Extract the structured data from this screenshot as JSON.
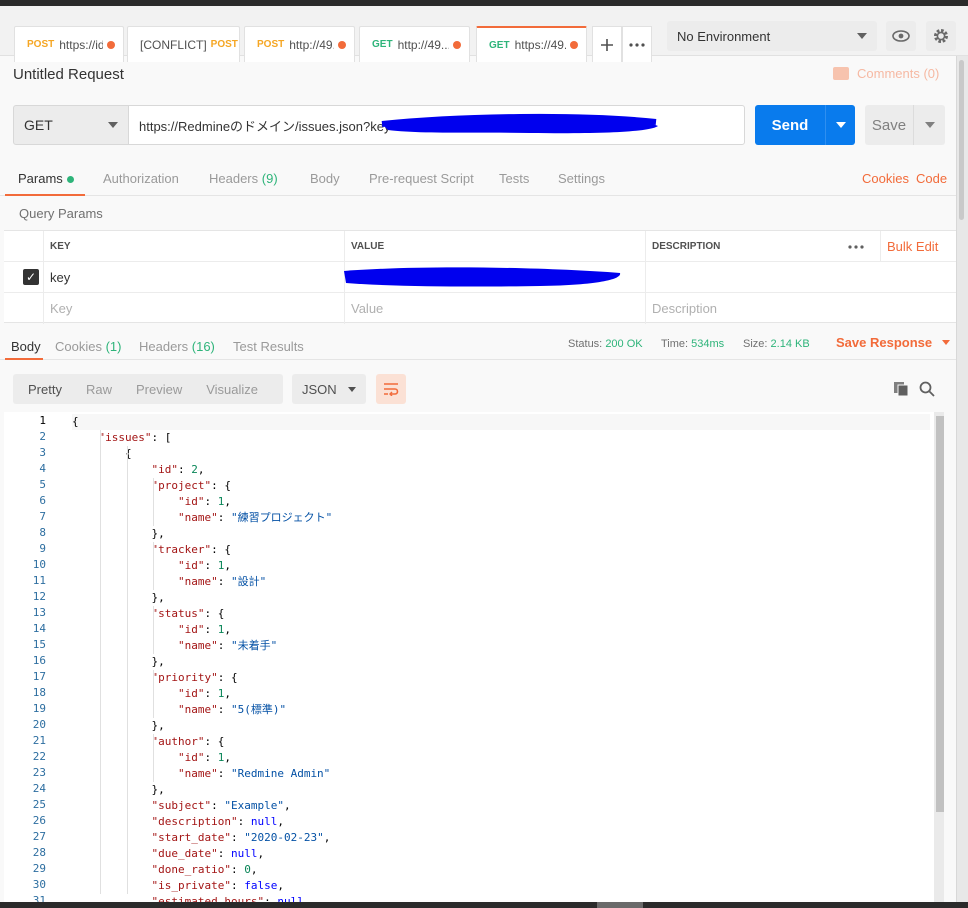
{
  "tabs": [
    {
      "method": "POST",
      "url": "https://id..."
    },
    {
      "method": "POST",
      "url": "",
      "prefix": "[CONFLICT]"
    },
    {
      "method": "POST",
      "url": "http://49...."
    },
    {
      "method": "GET",
      "url": "http://49...."
    },
    {
      "method": "GET",
      "url": "https://49...."
    }
  ],
  "environment": {
    "selected": "No Environment"
  },
  "request": {
    "title": "Untitled Request",
    "comments_label": "Comments (0)",
    "method": "GET",
    "url": "https://Redmineのドメイン/issues.json?key=",
    "send_label": "Send",
    "save_label": "Save"
  },
  "request_tabs": [
    {
      "label": "Params"
    },
    {
      "label": "Authorization"
    },
    {
      "label": "Headers",
      "count": "(9)"
    },
    {
      "label": "Body"
    },
    {
      "label": "Pre-request Script"
    },
    {
      "label": "Tests"
    },
    {
      "label": "Settings"
    }
  ],
  "links": {
    "cookies": "Cookies",
    "code": "Code"
  },
  "query_params": {
    "title": "Query Params",
    "headers": {
      "key": "KEY",
      "value": "VALUE",
      "description": "DESCRIPTION"
    },
    "bulk_edit": "Bulk Edit",
    "rows": [
      {
        "key": "key",
        "checked": true
      }
    ],
    "placeholders": {
      "key": "Key",
      "value": "Value",
      "description": "Description"
    }
  },
  "response_tabs": [
    {
      "label": "Body"
    },
    {
      "label": "Cookies",
      "count": "(1)"
    },
    {
      "label": "Headers",
      "count": "(16)"
    },
    {
      "label": "Test Results"
    }
  ],
  "response_meta": {
    "status_label": "Status:",
    "status_value": "200 OK",
    "time_label": "Time:",
    "time_value": "534ms",
    "size_label": "Size:",
    "size_value": "2.14 KB",
    "save_response": "Save Response"
  },
  "view_modes": [
    "Pretty",
    "Raw",
    "Preview",
    "Visualize"
  ],
  "format": "JSON",
  "code_lines": [
    "{",
    "    \"issues\": [",
    "        {",
    "            \"id\": 2,",
    "            \"project\": {",
    "                \"id\": 1,",
    "                \"name\": \"練習プロジェクト\"",
    "            },",
    "            \"tracker\": {",
    "                \"id\": 1,",
    "                \"name\": \"設計\"",
    "            },",
    "            \"status\": {",
    "                \"id\": 1,",
    "                \"name\": \"未着手\"",
    "            },",
    "            \"priority\": {",
    "                \"id\": 1,",
    "                \"name\": \"5(標準)\"",
    "            },",
    "            \"author\": {",
    "                \"id\": 1,",
    "                \"name\": \"Redmine Admin\"",
    "            },",
    "            \"subject\": \"Example\",",
    "            \"description\": null,",
    "            \"start_date\": \"2020-02-23\",",
    "            \"due_date\": null,",
    "            \"done_ratio\": 0,",
    "            \"is_private\": false,",
    "            \"estimated_hours\": null,"
  ]
}
